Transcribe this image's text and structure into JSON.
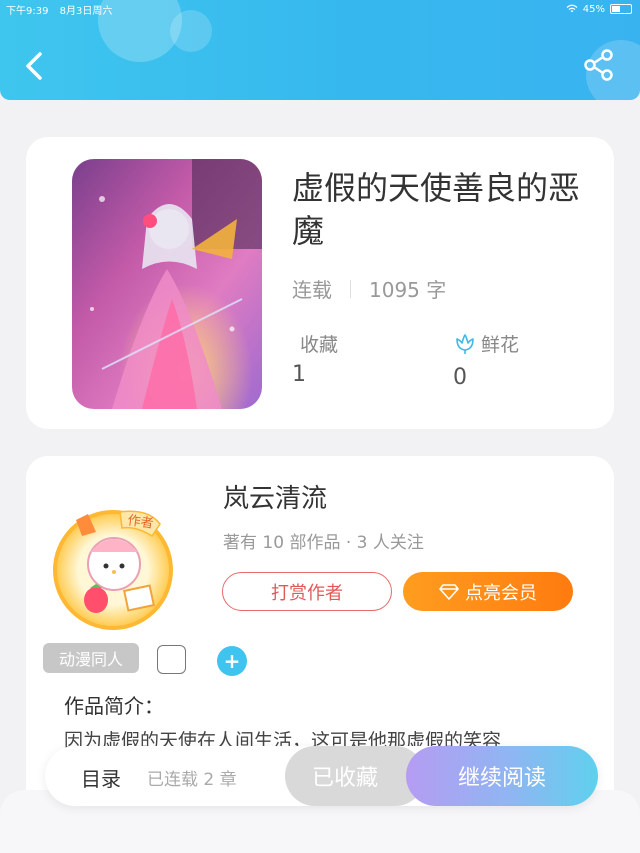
{
  "status_bar": {
    "time": "下午9:39",
    "date": "8月3日周六",
    "battery": "45%"
  },
  "book": {
    "title": "虚假的天使善良的恶魔",
    "status": "连载",
    "word_count": "1095 字",
    "favorites_label": "收藏",
    "favorites_value": "1",
    "flowers_label": "鲜花",
    "flowers_value": "0"
  },
  "author": {
    "name": "岚云清流",
    "meta": "著有 10 部作品 · 3 人关注",
    "avatar_badge": "作者",
    "tip_label": "打赏作者",
    "vip_label": "点亮会员"
  },
  "tags": [
    "动漫同人"
  ],
  "intro": {
    "heading": "作品简介：",
    "text": "因为虚假的天使在人间生活，这可是他那虚假的笑容"
  },
  "bottom": {
    "toc_label": "目录",
    "chapters": "已连载 2 章",
    "collected_label": "已收藏",
    "continue_label": "继续阅读"
  },
  "colors": {
    "header": "#3fc6ee",
    "accent_orange": "#ff8a14",
    "tip_red": "#e05a5a"
  },
  "icons": {
    "back": "chevron-left-icon",
    "share": "share-icon",
    "flower": "flower-icon",
    "vip": "diamond-icon",
    "add": "plus-icon"
  }
}
